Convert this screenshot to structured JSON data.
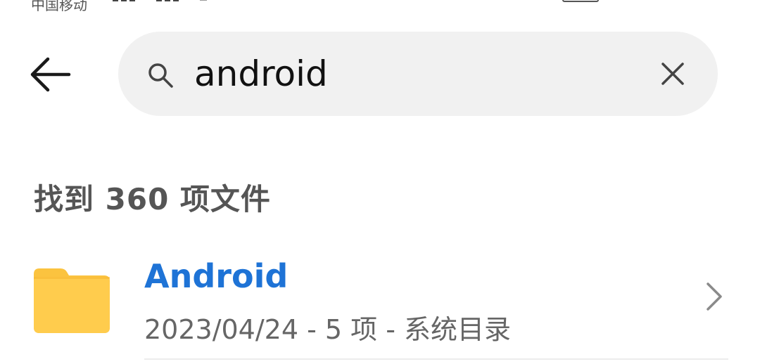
{
  "status_bar": {
    "carrier": "中国移动"
  },
  "search": {
    "query": "android",
    "placeholder": ""
  },
  "results": {
    "summary": "找到 360 项文件",
    "items": [
      {
        "title": "Android",
        "meta": "2023/04/24 - 5 项 - 系统目录",
        "icon": "folder-icon"
      }
    ]
  },
  "colors": {
    "accent": "#1e73d6",
    "folder": "#fbc33f",
    "search_bg": "#f1f1f1"
  }
}
